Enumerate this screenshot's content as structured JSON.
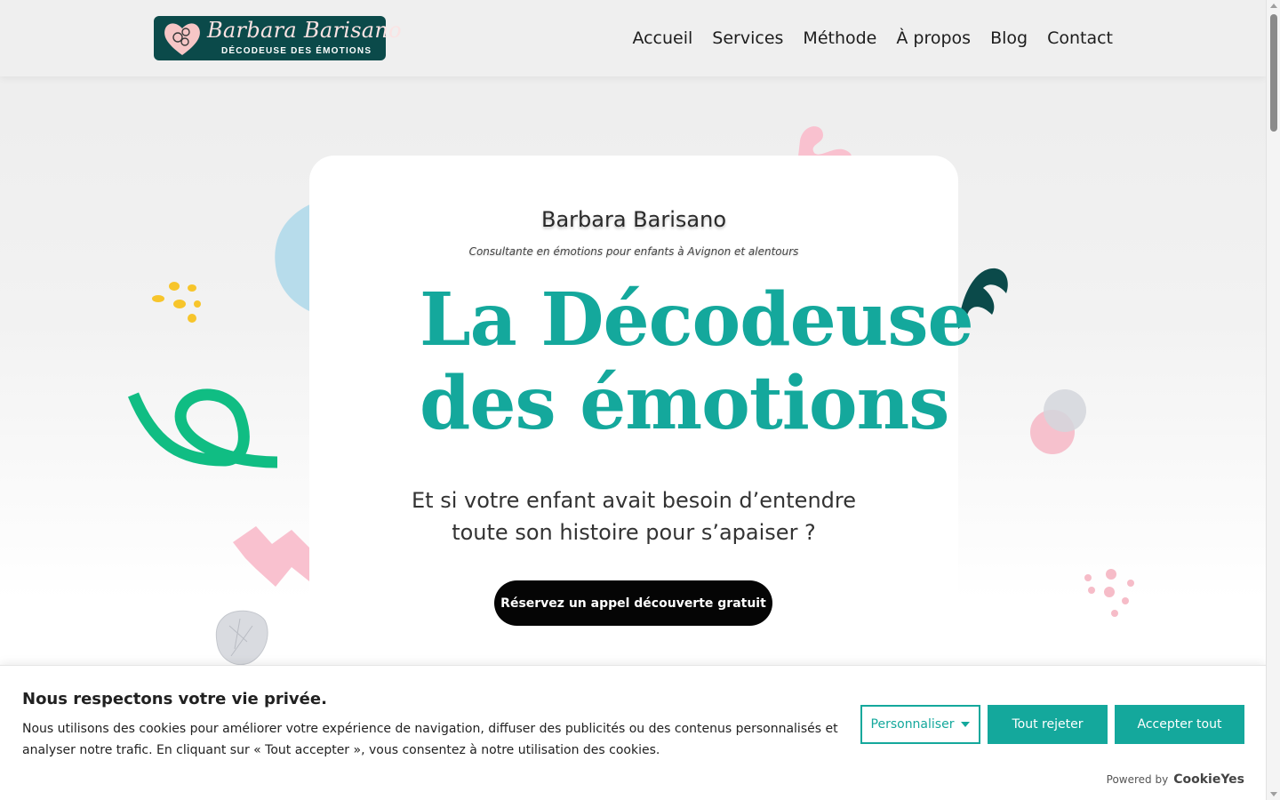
{
  "header": {
    "logo_name": "Barbara Barisano",
    "logo_sub": "DÉCODEUSE DES ÉMOTIONS",
    "nav": [
      "Accueil",
      "Services",
      "Méthode",
      "À propos",
      "Blog",
      "Contact"
    ]
  },
  "hero": {
    "name": "Barbara Barisano",
    "tagline": "Consultante en émotions pour enfants à Avignon et alentours",
    "title_line1": "La Décodeuse",
    "title_line2": "des émotions",
    "lead_line1": "Et si votre enfant avait besoin d’entendre",
    "lead_line2": "toute son histoire pour s’apaiser ?",
    "cta": "Réservez un appel découverte gratuit"
  },
  "cookie": {
    "title": "Nous respectons votre vie privée.",
    "text": "Nous utilisons des cookies pour améliorer votre expérience de navigation, diffuser des publicités ou des contenus personnalisés et analyser notre trafic. En cliquant sur « Tout accepter », vous consentez à notre utilisation des cookies.",
    "customize": "Personnaliser",
    "reject": "Tout rejeter",
    "accept": "Accepter tout",
    "powered_by": "Powered by",
    "brand": "CookieYes"
  },
  "colors": {
    "accent": "#14a89c",
    "logo_bg": "#0b4a4a",
    "cta_bg": "#050505"
  }
}
